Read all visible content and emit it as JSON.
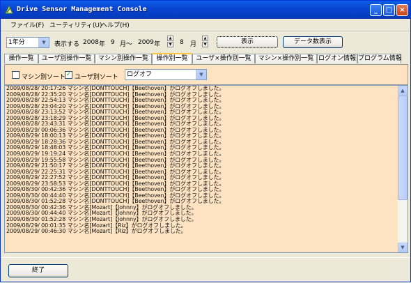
{
  "window": {
    "title": "Drive Sensor Management Console"
  },
  "menu": [
    "ファイル(F)",
    "ユーティリティ(U)",
    "ヘルプ(H)"
  ],
  "toolbar": {
    "period": "1年分",
    "display_label": "表示する",
    "from_year": "2008",
    "year_unit1": "年",
    "from_month": "9",
    "month_unit1": "月～",
    "to_year": "2009",
    "year_unit2": "年",
    "to_month": "8",
    "month_unit2": "月",
    "show_button": "表示",
    "count_button": "データ数表示"
  },
  "tabs": [
    "操作一覧",
    "ユーザ別操作一覧",
    "マシン別操作一覧",
    "操作別一覧",
    "ユーザ×操作別一覧",
    "マシン×操作別一覧",
    "ログオン情報",
    "プログラム情報"
  ],
  "active_tab": 3,
  "filters": {
    "machine_sort_label": "マシン別ソート",
    "machine_sort_checked": false,
    "user_sort_label": "ユーザ別ソート",
    "user_sort_checked": true,
    "operation": "ログオフ"
  },
  "log_rows": [
    "2009/08/28/ 20:17:26 マシン名[DONTTOUCH]【Beethoven】がログオフしました。",
    "2009/08/28/ 22:35:20 マシン名[DONTTOUCH]【Beethoven】がログオフしました。",
    "2009/08/28/ 22:54:13 マシン名[DONTTOUCH]【Beethoven】がログオフしました。",
    "2009/08/28/ 23:04:20 マシン名[DONTTOUCH]【Beethoven】がログオフしました。",
    "2009/08/28/ 23:13:52 マシン名[DONTTOUCH]【Beethoven】がログオフしました。",
    "2009/08/28/ 23:18:29 マシン名[DONTTOUCH]【Beethoven】がログオフしました。",
    "2009/08/28/ 23:43:31 マシン名[DONTTOUCH]【Beethoven】がログオフしました。",
    "2009/08/29/ 00:06:36 マシン名[DONTTOUCH]【Beethoven】がログオフしました。",
    "2009/08/29/ 18:00:13 マシン名[DONTTOUCH]【Beethoven】がログオフしました。",
    "2009/08/29/ 18:28:36 マシン名[DONTTOUCH]【Beethoven】がログオフしました。",
    "2009/08/29/ 18:48:03 マシン名[DONTTOUCH]【Beethoven】がログオフしました。",
    "2009/08/29/ 19:19:24 マシン名[DONTTOUCH]【Beethoven】がログオフしました。",
    "2009/08/29/ 19:55:58 マシン名[DONTTOUCH]【Beethoven】がログオフしました。",
    "2009/08/29/ 21:50:17 マシン名[DONTTOUCH]【Beethoven】がログオフしました。",
    "2009/08/29/ 22:25:31 マシン名[DONTTOUCH]【Beethoven】がログオフしました。",
    "2009/08/29/ 22:27:52 マシン名[DONTTOUCH]【Beethoven】がログオフしました。",
    "2009/08/29/ 23:58:53 マシン名[DONTTOUCH]【Beethoven】がログオフしました。",
    "2009/08/30/ 00:42:36 マシン名[DONTTOUCH]【Beethoven】がログオフしました。",
    "2009/08/30/ 00:44:40 マシン名[DONTTOUCH]【Beethoven】がログオフしました。",
    "2009/08/30/ 01:52:28 マシン名[DONTTOUCH]【Beethoven】がログオフしました。",
    "2009/08/30/ 00:42:36 マシン名[Mozart]【Johnny】がログオフしました。",
    "2009/08/30/ 00:44:40 マシン名[Mozart]【Johnny】がログオフしました。",
    "2009/08/30/ 01:52:28 マシン名[Mozart]【Johnny】がログオフしました。",
    "2009/08/29/ 00:01:35 マシン名[Mozart]【Riz】がログオフしました。",
    "2009/08/29/ 00:46:30 マシン名[Mozart]【Riz】がログオフしました。",
    "",
    "",
    "",
    ""
  ],
  "footer": {
    "exit_button": "終了"
  }
}
